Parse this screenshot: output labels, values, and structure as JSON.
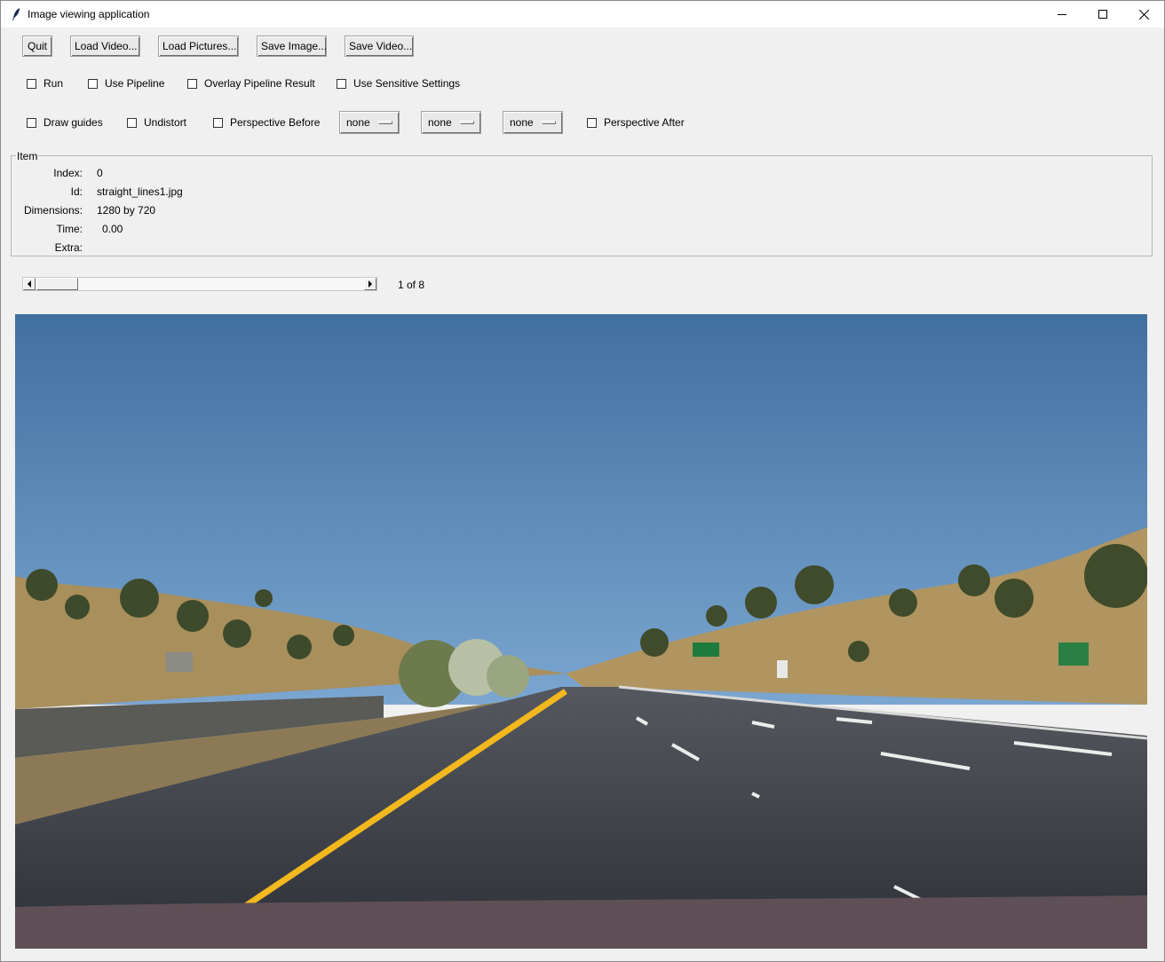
{
  "window": {
    "title": "Image viewing application",
    "controls": [
      "minimize-icon",
      "maximize-icon",
      "close-icon"
    ]
  },
  "toolbar": {
    "quit": "Quit",
    "load_video": "Load Video...",
    "load_pictures": "Load Pictures...",
    "save_image": "Save Image...",
    "save_video": "Save Video..."
  },
  "options_row1": {
    "run": "Run",
    "use_pipeline": "Use Pipeline",
    "overlay_pipeline_result": "Overlay Pipeline Result",
    "use_sensitive_settings": "Use Sensitive Settings"
  },
  "options_row2": {
    "draw_guides": "Draw guides",
    "undistort": "Undistort",
    "perspective_before": "Perspective Before",
    "menus": [
      "none",
      "none",
      "none"
    ],
    "perspective_after": "Perspective After"
  },
  "item": {
    "frame_label": "Item",
    "labels": {
      "index": "Index:",
      "id": "Id:",
      "dimensions": "Dimensions:",
      "time": "Time:",
      "extra": "Extra:"
    },
    "values": {
      "index": "0",
      "id": "straight_lines1.jpg",
      "dimensions": "1280 by 720",
      "time": "0.00",
      "extra": ""
    }
  },
  "navigation": {
    "counter": "1 of 8",
    "position_fraction": 0.0
  },
  "colors": {
    "sky": "#5a86b8",
    "road": "#3b3d45",
    "yellow_line": "#f2b81e",
    "grass": "#a88f5c"
  }
}
